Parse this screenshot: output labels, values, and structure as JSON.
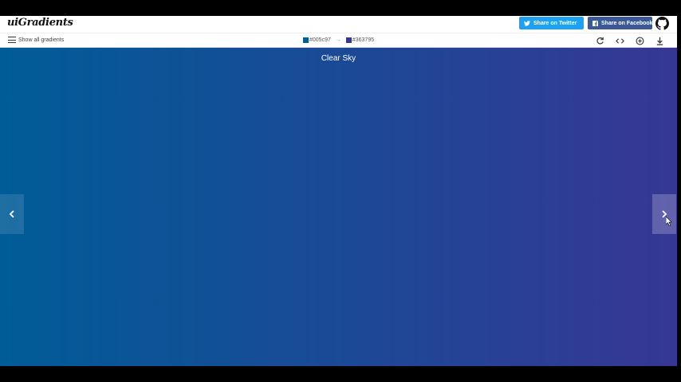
{
  "header": {
    "logo": "uiGradients",
    "twitter_label": "Share on Twitter",
    "facebook_label": "Share on Facebook"
  },
  "toolbar": {
    "show_all_label": "Show all gradients",
    "color_start": "#005c97",
    "color_end": "#363795",
    "arrow": "→"
  },
  "gradient": {
    "name": "Clear Sky"
  },
  "colors": {
    "twitter": "#1da1f2",
    "facebook": "#3b5998"
  },
  "icons": [
    "twitter-icon",
    "facebook-icon",
    "github-icon",
    "hamburger-icon",
    "rotate-icon",
    "code-icon",
    "add-icon",
    "download-icon",
    "chevron-left-icon",
    "chevron-right-icon"
  ]
}
